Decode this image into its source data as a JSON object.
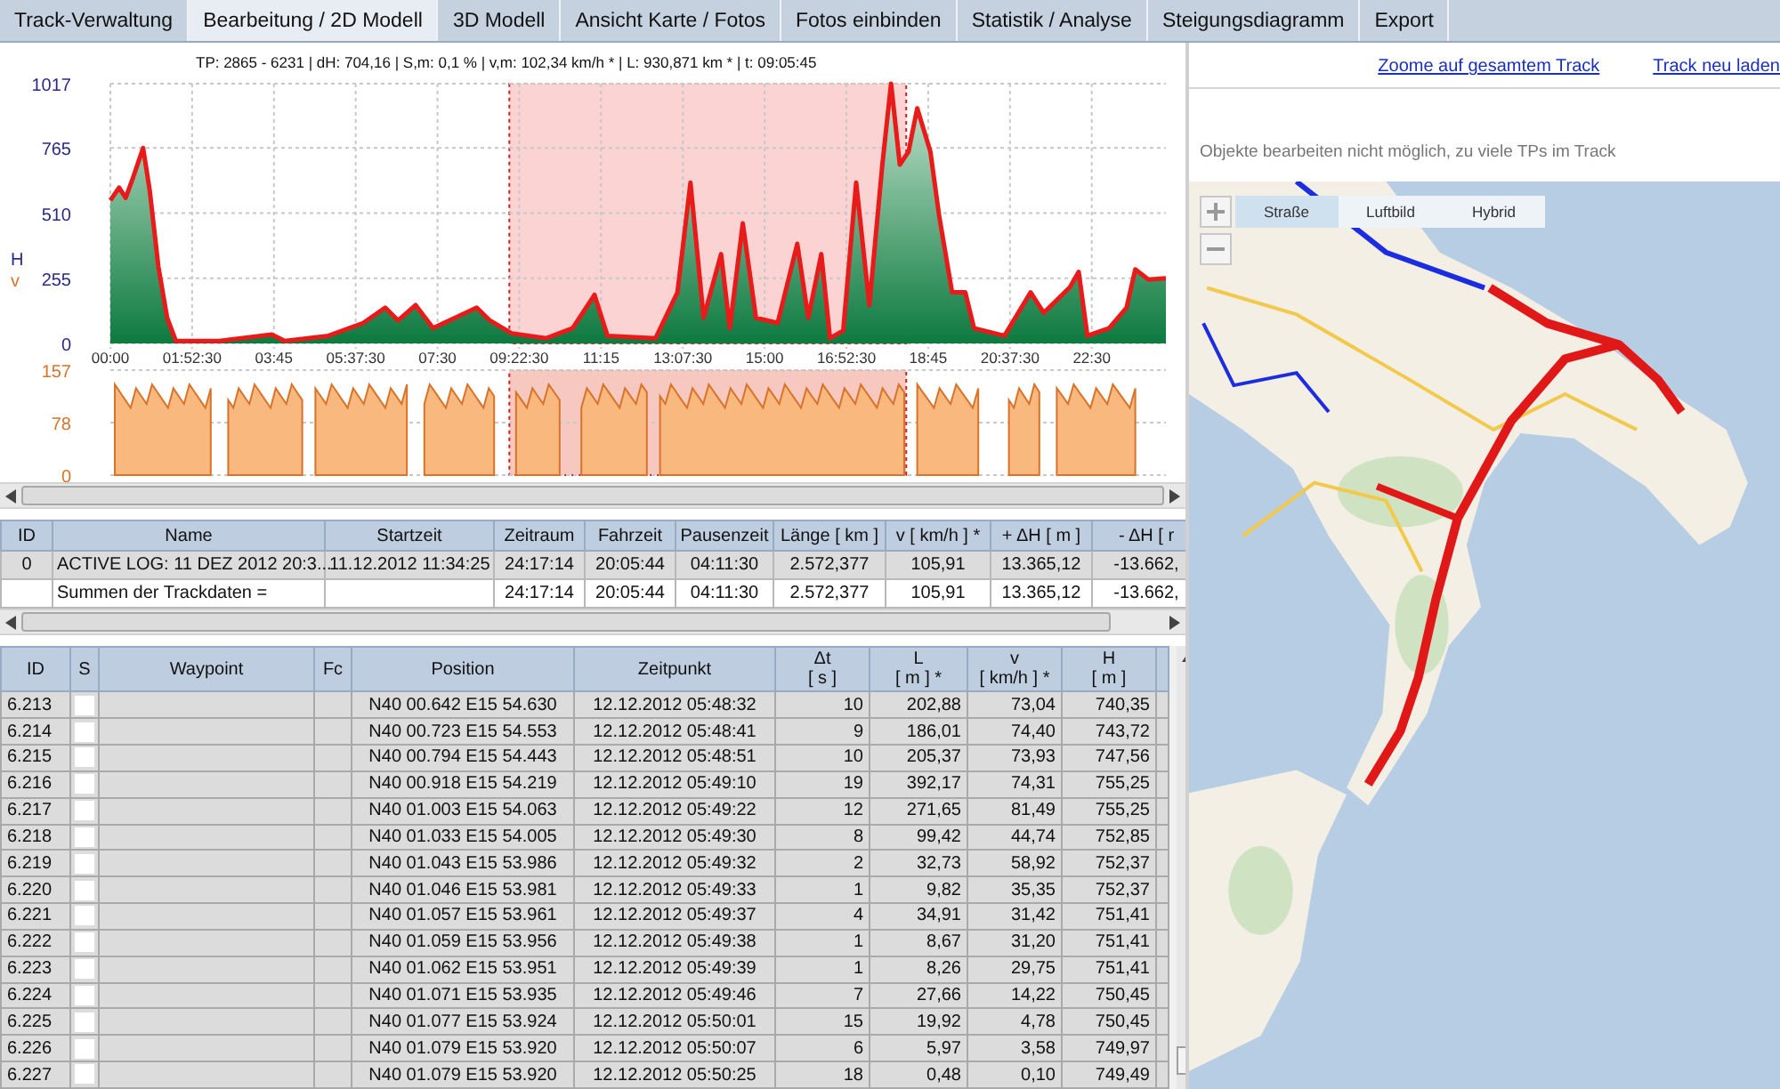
{
  "tabs": [
    {
      "label": "Track-Verwaltung",
      "selected": false
    },
    {
      "label": "Bearbeitung / 2D Modell",
      "selected": true
    },
    {
      "label": "3D Modell",
      "selected": false
    },
    {
      "label": "Ansicht Karte / Fotos",
      "selected": false
    },
    {
      "label": "Fotos einbinden",
      "selected": false
    },
    {
      "label": "Statistik / Analyse",
      "selected": false
    },
    {
      "label": "Steigungsdiagramm",
      "selected": false
    },
    {
      "label": "Export",
      "selected": false
    }
  ],
  "profile": {
    "info": "TP: 2865 - 6231 | dH: 704,16  | S,m: 0,1 % | v,m: 102,34 km/h * | L: 930,871 km * | t: 09:05:45",
    "elevation": {
      "chart_data": {
        "type": "area",
        "grid": true,
        "ylabel": "H",
        "xlim": [
          0,
          24.2
        ],
        "ylim": [
          0,
          1017
        ],
        "yticks": [
          0,
          255,
          510,
          765,
          1017
        ],
        "xticks": [
          {
            "value": 0,
            "label": "00:00"
          },
          {
            "value": 1.875,
            "label": "01:52:30"
          },
          {
            "value": 3.75,
            "label": "03:45"
          },
          {
            "value": 5.625,
            "label": "05:37:30"
          },
          {
            "value": 7.5,
            "label": "07:30"
          },
          {
            "value": 9.375,
            "label": "09:22:30"
          },
          {
            "value": 11.25,
            "label": "11:15"
          },
          {
            "value": 13.125,
            "label": "13:07:30"
          },
          {
            "value": 15,
            "label": "15:00"
          },
          {
            "value": 16.875,
            "label": "16:52:30"
          },
          {
            "value": 18.75,
            "label": "18:45"
          },
          {
            "value": 20.625,
            "label": "20:37:30"
          },
          {
            "value": 22.5,
            "label": "22:30"
          }
        ],
        "x": [
          0,
          0.2,
          0.35,
          0.5,
          0.75,
          0.9,
          1.1,
          1.3,
          1.5,
          2.5,
          3.7,
          4,
          5,
          5.8,
          6.3,
          6.6,
          7,
          7.4,
          8.4,
          8.7,
          9.2,
          10,
          10.6,
          11.1,
          11.4,
          12.5,
          13,
          13.3,
          13.6,
          14,
          14.2,
          14.5,
          14.8,
          15.3,
          15.75,
          16,
          16.3,
          16.5,
          16.8,
          17.1,
          17.4,
          17.7,
          17.9,
          18.1,
          18.3,
          18.5,
          18.8,
          19,
          19.3,
          19.6,
          19.8,
          20.5,
          21.1,
          21.4,
          22,
          22.2,
          22.4,
          22.9,
          23.3,
          23.5,
          23.8,
          24.2
        ],
        "series": [
          {
            "color": "#e81a1a",
            "values": [
              560,
              610,
              570,
              640,
              765,
              600,
              300,
              100,
              10,
              10,
              35,
              10,
              30,
              80,
              140,
              90,
              150,
              60,
              140,
              90,
              40,
              20,
              60,
              190,
              30,
              20,
              200,
              630,
              100,
              350,
              60,
              470,
              100,
              80,
              390,
              100,
              350,
              20,
              50,
              630,
              150,
              700,
              1017,
              700,
              750,
              920,
              750,
              500,
              200,
              200,
              60,
              30,
              200,
              120,
              220,
              280,
              30,
              60,
              140,
              290,
              250,
              255
            ]
          }
        ]
      }
    },
    "speed": {
      "label": "v",
      "ticks": [
        "157",
        "78",
        "0"
      ]
    }
  },
  "summary": {
    "columns": [
      "ID",
      "Name",
      "Startzeit",
      "Zeitraum",
      "Fahrzeit",
      "Pausenzeit",
      "Länge  [ km ]",
      "v  [ km/h ] *",
      "+ ΔH  [ m ]",
      "- ΔH  [ r"
    ],
    "rows": [
      {
        "selected": true,
        "cells": [
          "0",
          "ACTIVE LOG: 11 DEZ 2012 20:3...",
          "11.12.2012 11:34:25",
          "24:17:14",
          "20:05:44",
          "04:11:30",
          "2.572,377",
          "105,91",
          "13.365,12",
          "-13.662,"
        ]
      },
      {
        "selected": false,
        "cells": [
          "",
          "Summen der Trackdaten =",
          "",
          "24:17:14",
          "20:05:44",
          "04:11:30",
          "2.572,377",
          "105,91",
          "13.365,12",
          "-13.662,"
        ]
      }
    ]
  },
  "waypoints": {
    "columns": [
      {
        "kind": "text",
        "lines": [
          "ID"
        ]
      },
      {
        "kind": "checkbox",
        "lines": [
          "S"
        ]
      },
      {
        "kind": "text",
        "lines": [
          "Waypoint"
        ]
      },
      {
        "kind": "text",
        "lines": [
          "Fc"
        ]
      },
      {
        "kind": "text",
        "lines": [
          "Position"
        ]
      },
      {
        "kind": "text",
        "lines": [
          "Zeitpunkt"
        ]
      },
      {
        "kind": "number",
        "lines": [
          "Δt",
          "[ s ]"
        ]
      },
      {
        "kind": "number",
        "lines": [
          "L",
          "[ m ] *"
        ]
      },
      {
        "kind": "number",
        "lines": [
          "v",
          "[ km/h ] *"
        ]
      },
      {
        "kind": "number",
        "lines": [
          "H",
          "[ m ]"
        ]
      }
    ],
    "rows": [
      {
        "checked": false,
        "cells": [
          "6.213",
          "",
          "",
          "",
          "N40 00.642 E15 54.630",
          "12.12.2012 05:48:32",
          "10",
          "202,88",
          "73,04",
          "740,35"
        ]
      },
      {
        "checked": false,
        "cells": [
          "6.214",
          "",
          "",
          "",
          "N40 00.723 E15 54.553",
          "12.12.2012 05:48:41",
          "9",
          "186,01",
          "74,40",
          "743,72"
        ]
      },
      {
        "checked": false,
        "cells": [
          "6.215",
          "",
          "",
          "",
          "N40 00.794 E15 54.443",
          "12.12.2012 05:48:51",
          "10",
          "205,37",
          "73,93",
          "747,56"
        ]
      },
      {
        "checked": false,
        "cells": [
          "6.216",
          "",
          "",
          "",
          "N40 00.918 E15 54.219",
          "12.12.2012 05:49:10",
          "19",
          "392,17",
          "74,31",
          "755,25"
        ]
      },
      {
        "checked": false,
        "cells": [
          "6.217",
          "",
          "",
          "",
          "N40 01.003 E15 54.063",
          "12.12.2012 05:49:22",
          "12",
          "271,65",
          "81,49",
          "755,25"
        ]
      },
      {
        "checked": false,
        "cells": [
          "6.218",
          "",
          "",
          "",
          "N40 01.033 E15 54.005",
          "12.12.2012 05:49:30",
          "8",
          "99,42",
          "44,74",
          "752,85"
        ]
      },
      {
        "checked": false,
        "cells": [
          "6.219",
          "",
          "",
          "",
          "N40 01.043 E15 53.986",
          "12.12.2012 05:49:32",
          "2",
          "32,73",
          "58,92",
          "752,37"
        ]
      },
      {
        "checked": false,
        "cells": [
          "6.220",
          "",
          "",
          "",
          "N40 01.046 E15 53.981",
          "12.12.2012 05:49:33",
          "1",
          "9,82",
          "35,35",
          "752,37"
        ]
      },
      {
        "checked": false,
        "cells": [
          "6.221",
          "",
          "",
          "",
          "N40 01.057 E15 53.961",
          "12.12.2012 05:49:37",
          "4",
          "34,91",
          "31,42",
          "751,41"
        ]
      },
      {
        "checked": false,
        "cells": [
          "6.222",
          "",
          "",
          "",
          "N40 01.059 E15 53.956",
          "12.12.2012 05:49:38",
          "1",
          "8,67",
          "31,20",
          "751,41"
        ]
      },
      {
        "checked": false,
        "cells": [
          "6.223",
          "",
          "",
          "",
          "N40 01.062 E15 53.951",
          "12.12.2012 05:49:39",
          "1",
          "8,26",
          "29,75",
          "751,41"
        ]
      },
      {
        "checked": false,
        "cells": [
          "6.224",
          "",
          "",
          "",
          "N40 01.071 E15 53.935",
          "12.12.2012 05:49:46",
          "7",
          "27,66",
          "14,22",
          "750,45"
        ]
      },
      {
        "checked": false,
        "cells": [
          "6.225",
          "",
          "",
          "",
          "N40 01.077 E15 53.924",
          "12.12.2012 05:50:01",
          "15",
          "19,92",
          "4,78",
          "750,45"
        ]
      },
      {
        "checked": false,
        "cells": [
          "6.226",
          "",
          "",
          "",
          "N40 01.079 E15 53.920",
          "12.12.2012 05:50:07",
          "6",
          "5,97",
          "3,58",
          "749,97"
        ]
      },
      {
        "checked": false,
        "cells": [
          "6.227",
          "",
          "",
          "",
          "N40 01.079 E15 53.920",
          "12.12.2012 05:50:25",
          "18",
          "0,48",
          "0,10",
          "749,49"
        ]
      }
    ]
  },
  "map": {
    "links": [
      "Zoome auf gesamtem Track",
      "Track neu laden"
    ],
    "notice": "Objekte bearbeiten nicht möglich, zu viele TPs im Track",
    "view_modes": [
      {
        "label": "Straße",
        "selected": true
      },
      {
        "label": "Luftbild",
        "selected": false
      },
      {
        "label": "Hybrid",
        "selected": false
      }
    ]
  }
}
